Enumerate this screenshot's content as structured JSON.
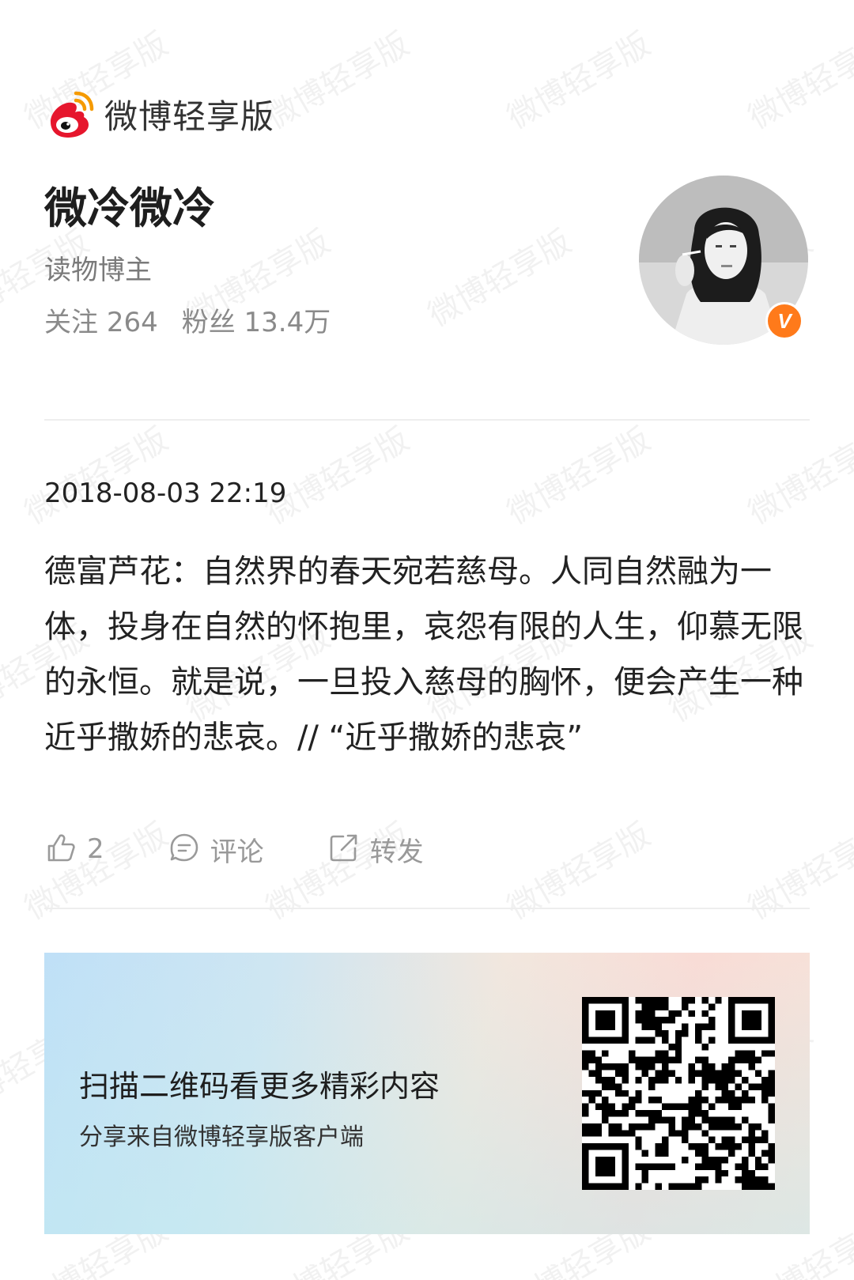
{
  "brand": {
    "name": "微博轻享版",
    "icon": "weibo-logo-icon",
    "colors": {
      "red": "#e6162d",
      "yellow": "#f59a00"
    }
  },
  "watermark": {
    "text": "微博轻享版"
  },
  "profile": {
    "name": "微冷微冷",
    "role": "读物博主",
    "following_label": "关注",
    "following_count": "264",
    "followers_label": "粉丝",
    "followers_count": "13.4万",
    "verified_badge": "V",
    "verified_color": "#ff7a1a"
  },
  "post": {
    "timestamp": "2018-08-03 22:19",
    "text": "德富芦花：自然界的春天宛若慈母。人同自然融为一体，投身在自然的怀抱里，哀怨有限的人生，仰慕无限的永恒。就是说，一旦投入慈母的胸怀，便会产生一种近乎撒娇的悲哀。// “近乎撒娇的悲哀”"
  },
  "actions": {
    "like": {
      "icon": "thumbs-up-icon",
      "count": "2"
    },
    "comment": {
      "icon": "comment-icon",
      "label": "评论"
    },
    "repost": {
      "icon": "share-icon",
      "label": "转发"
    }
  },
  "promo": {
    "title": "扫描二维码看更多精彩内容",
    "subtitle": "分享来自微博轻享版客户端",
    "qr": "qr-code"
  }
}
